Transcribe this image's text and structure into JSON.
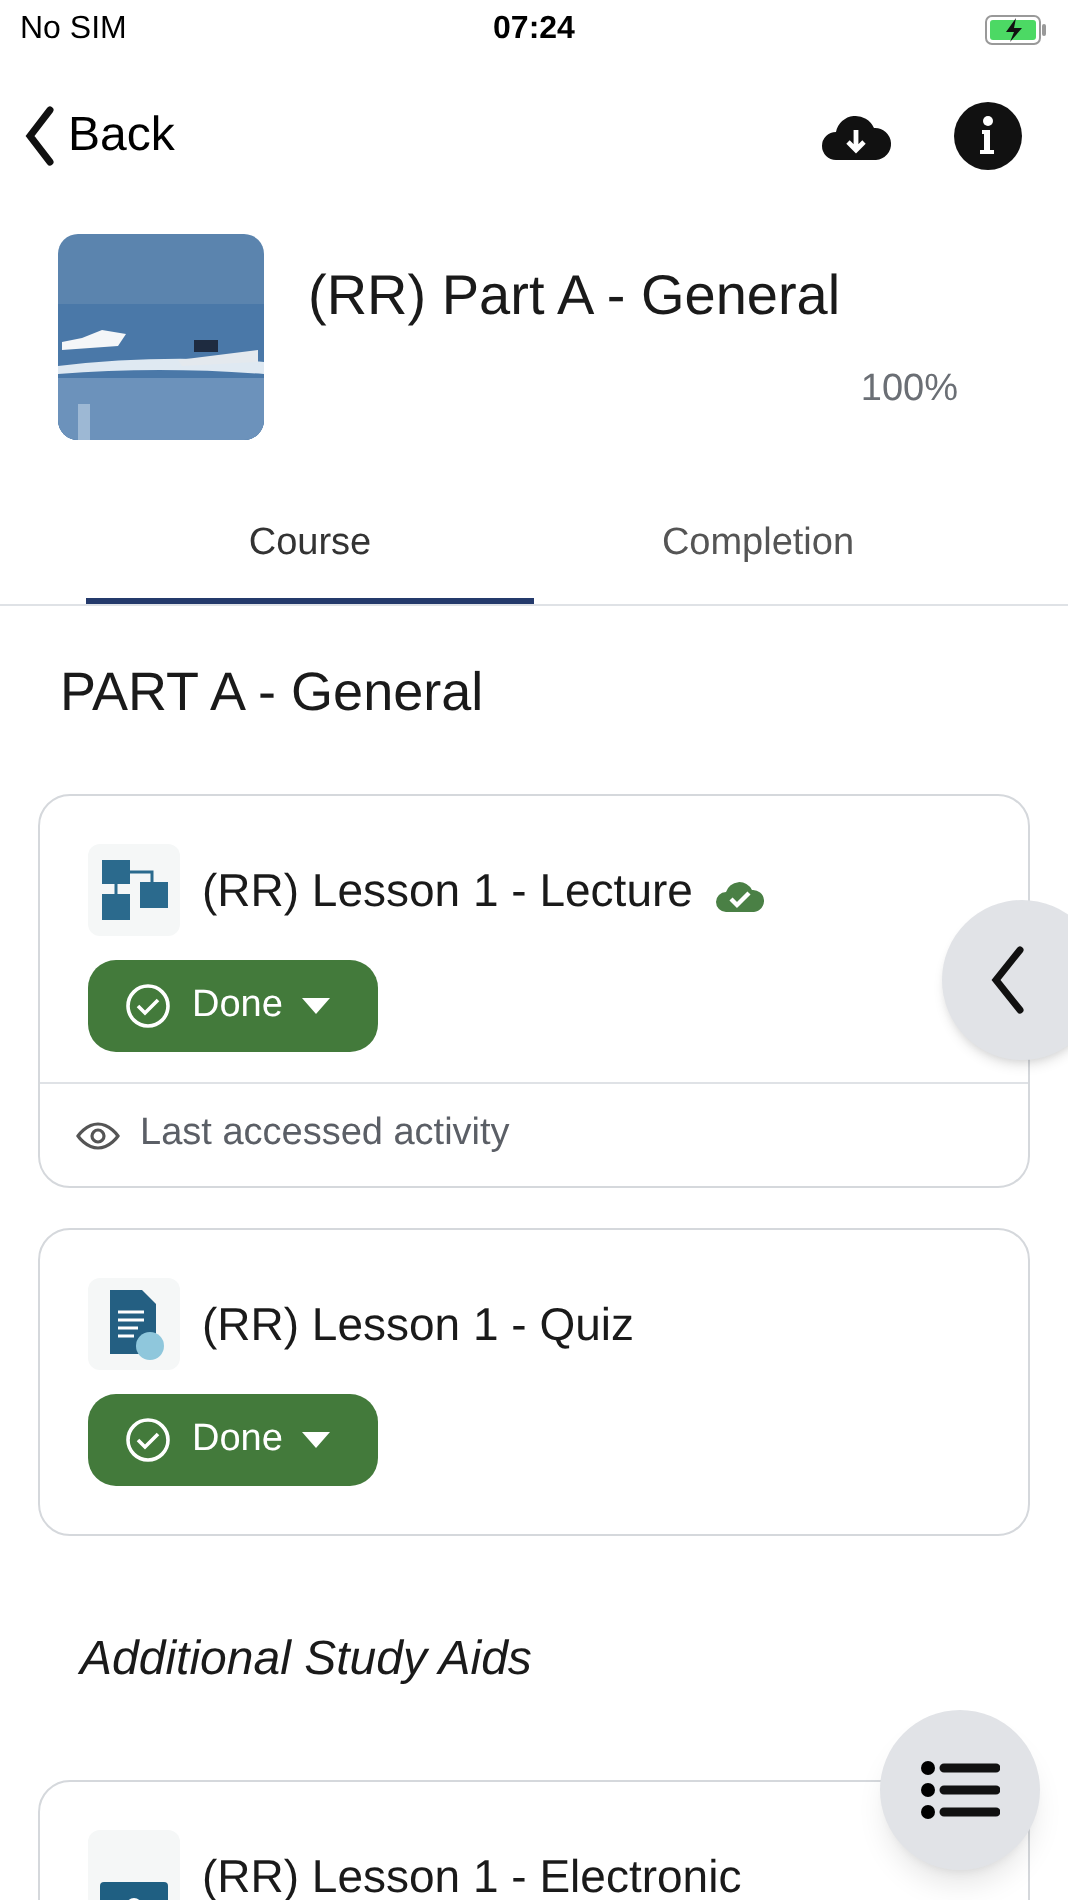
{
  "status_bar": {
    "carrier": "No SIM",
    "time": "07:24",
    "charging": true
  },
  "nav": {
    "back": "Back"
  },
  "course": {
    "title": "(RR) Part A - General",
    "progress": "100%"
  },
  "tabs": [
    {
      "label": "Course",
      "selected": true
    },
    {
      "label": "Completion",
      "selected": false
    }
  ],
  "section": {
    "title": "PART A - General"
  },
  "activities": [
    {
      "kind": "lecture",
      "title": "(RR) Lesson 1 - Lecture",
      "downloaded": true,
      "completion": "Done",
      "footer": "Last accessed activity"
    },
    {
      "kind": "quiz",
      "title": "(RR) Lesson 1 - Quiz",
      "downloaded": false,
      "completion": "Done"
    }
  ],
  "subheading": "Additional Study Aids",
  "more_activities": [
    {
      "kind": "h5p",
      "title": "(RR) Lesson 1 - Electronic",
      "downloaded": false
    }
  ]
}
